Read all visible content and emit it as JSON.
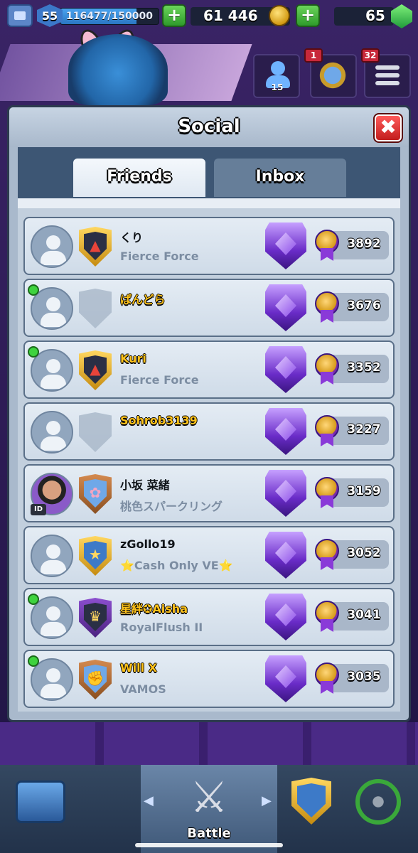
{
  "topbar": {
    "level": "55",
    "xp_text": "116477/150000",
    "xp_fraction": 0.776,
    "gold": "61 446",
    "gems": "65"
  },
  "header_buttons": {
    "friends_count": "15",
    "news_badge": "1",
    "menu_badge": "32"
  },
  "modal": {
    "title": "Social",
    "close_glyph": "✖",
    "tabs": [
      {
        "label": "Friends",
        "active": true
      },
      {
        "label": "Inbox",
        "active": false
      }
    ]
  },
  "friends": [
    {
      "name": "くり",
      "clan": "Fierce Force",
      "trophies": "3892",
      "online": false,
      "name_gold": false,
      "badge": "fire"
    },
    {
      "name": "ぱんどら",
      "clan": "",
      "trophies": "3676",
      "online": true,
      "name_gold": true,
      "badge": "none"
    },
    {
      "name": "Kuri",
      "clan": "Fierce Force",
      "trophies": "3352",
      "online": true,
      "name_gold": true,
      "badge": "fire"
    },
    {
      "name": "Sohrob3139",
      "clan": "",
      "trophies": "3227",
      "online": false,
      "name_gold": true,
      "badge": "none"
    },
    {
      "name": "小坂 菜緒",
      "clan": "桃色スパークリング",
      "trophies": "3159",
      "online": false,
      "name_gold": false,
      "badge": "flower",
      "has_photo": true,
      "id_tag": "ID"
    },
    {
      "name": "zGollo19",
      "clan": "⭐Cash Only VE⭐",
      "trophies": "3052",
      "online": false,
      "name_gold": false,
      "badge": "star"
    },
    {
      "name": "星絆✪Aisha",
      "clan": "RoyalFlush II",
      "trophies": "3041",
      "online": true,
      "name_gold": true,
      "badge": "crown"
    },
    {
      "name": "Will X",
      "clan": "VAMOS",
      "trophies": "3035",
      "online": true,
      "name_gold": true,
      "badge": "fist"
    }
  ],
  "nav": {
    "active_label": "Battle",
    "left_arrow": "◀",
    "right_arrow": "▶"
  }
}
